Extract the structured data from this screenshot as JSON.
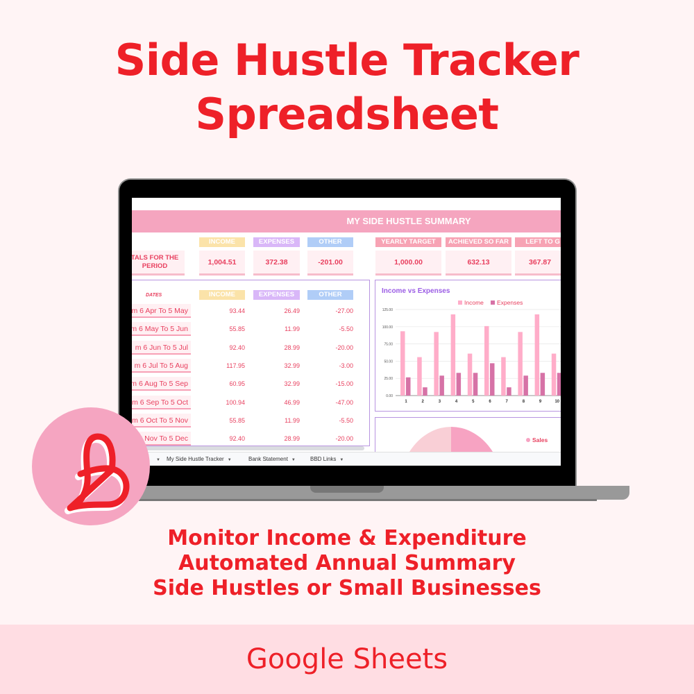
{
  "title": {
    "line1": "Side Hustle Tracker",
    "line2": "Spreadsheet"
  },
  "spreadsheet": {
    "summary_header": "MY SIDE HUSTLE SUMMARY",
    "totals": {
      "label": "TALS FOR THE PERIOD",
      "headers": {
        "income": "INCOME",
        "expenses": "EXPENSES",
        "other": "OTHER"
      },
      "income": "1,004.51",
      "expenses": "372.38",
      "other": "-201.00"
    },
    "targets": {
      "yearly_target_label": "YEARLY TARGET",
      "achieved_label": "ACHIEVED SO FAR",
      "left_label": "LEFT TO G",
      "yearly_target": "1,000.00",
      "achieved": "632.13",
      "left": "367.87"
    },
    "table": {
      "dates_label": "DATES",
      "headers": {
        "income": "INCOME",
        "expenses": "EXPENSES",
        "other": "OTHER"
      },
      "rows": [
        {
          "date": "m 6 Apr To 5 May",
          "income": "93.44",
          "expenses": "26.49",
          "other": "-27.00"
        },
        {
          "date": "m 6 May To 5 Jun",
          "income": "55.85",
          "expenses": "11.99",
          "other": "-5.50"
        },
        {
          "date": "m 6 Jun To 5 Jul",
          "income": "92.40",
          "expenses": "28.99",
          "other": "-20.00"
        },
        {
          "date": "m 6 Jul To 5 Aug",
          "income": "117.95",
          "expenses": "32.99",
          "other": "-3.00"
        },
        {
          "date": "m 6 Aug To 5 Sep",
          "income": "60.95",
          "expenses": "32.99",
          "other": "-15.00"
        },
        {
          "date": "m 6 Sep To 5 Oct",
          "income": "100.94",
          "expenses": "46.99",
          "other": "-47.00"
        },
        {
          "date": "m 6 Oct To 5 Nov",
          "income": "55.85",
          "expenses": "11.99",
          "other": "-5.50"
        },
        {
          "date": "m 6 Nov To 5 Dec",
          "income": "92.40",
          "expenses": "28.99",
          "other": "-20.00"
        }
      ]
    },
    "pie_legend": "Sales",
    "sheet_tabs": [
      {
        "label": ""
      },
      {
        "label": "My Side Hustle Tracker"
      },
      {
        "label": "Bank Statement"
      },
      {
        "label": "BBD Links"
      }
    ],
    "colors": {
      "income": "#ffadc9",
      "expenses": "#d672a6",
      "pie_a": "#f9cfd6",
      "pie_b": "#f7a3c2"
    }
  },
  "chart_data": {
    "type": "bar",
    "title": "Income vs Expenses",
    "categories": [
      "1",
      "2",
      "3",
      "4",
      "5",
      "6",
      "7",
      "8",
      "9",
      "10"
    ],
    "series": [
      {
        "name": "Income",
        "values": [
          93.44,
          55.85,
          92.4,
          117.95,
          60.95,
          100.94,
          55.85,
          92.4,
          117.95,
          60.95
        ]
      },
      {
        "name": "Expenses",
        "values": [
          26.49,
          11.99,
          28.99,
          32.99,
          32.99,
          46.99,
          11.99,
          28.99,
          32.99,
          32.99
        ]
      }
    ],
    "yticks": [
      "0.00",
      "25.00",
      "50.00",
      "75.00",
      "100.00",
      "125.00"
    ],
    "ylim": [
      0,
      125
    ],
    "xlabel": "",
    "ylabel": "",
    "grid": true,
    "legend": "top-center"
  },
  "badge": {
    "symbol": "£"
  },
  "features": [
    "Monitor Income & Expenditure",
    "Automated Annual Summary",
    "Side Hustles or Small Businesses"
  ],
  "footer": "Google Sheets"
}
